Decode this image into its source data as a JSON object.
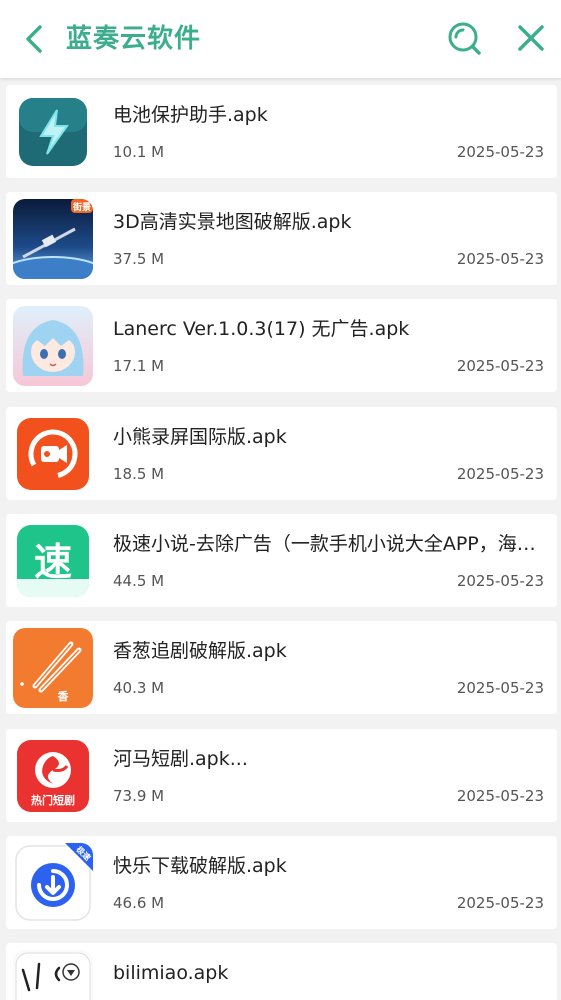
{
  "header": {
    "title": "蓝奏云软件",
    "accent_color": "#3cae8e",
    "back_icon": "chevron-left-icon",
    "search_icon": "search-icon",
    "close_icon": "close-icon"
  },
  "files": [
    {
      "name": "电池保护助手.apk",
      "size": "10.1 M",
      "date": "2025-05-23",
      "icon": "battery-bolt-app-icon"
    },
    {
      "name": "3D高清实景地图破解版.apk",
      "size": "37.5 M",
      "date": "2025-05-23",
      "icon": "satellite-map-app-icon",
      "badge": "街景"
    },
    {
      "name": "Lanerc Ver.1.0.3(17) 无广告.apk",
      "size": "17.1 M",
      "date": "2025-05-23",
      "icon": "anime-girl-app-icon"
    },
    {
      "name": "小熊录屏国际版.apk",
      "size": "18.5 M",
      "date": "2025-05-23",
      "icon": "screen-recorder-app-icon"
    },
    {
      "name": "极速小说-去除广告（一款手机小说大全APP，海量小说免费阅读）.apk",
      "size": "44.5 M",
      "date": "2025-05-23",
      "icon": "speed-novel-app-icon",
      "glyph": "速"
    },
    {
      "name": "香葱追剧破解版.apk",
      "size": "40.3 M",
      "date": "2025-05-23",
      "icon": "scallion-drama-app-icon",
      "glyph": "香"
    },
    {
      "name": "河马短剧.apk...",
      "size": "73.9 M",
      "date": "2025-05-23",
      "icon": "hippo-drama-app-icon",
      "badge": "热门短剧"
    },
    {
      "name": "快乐下载破解版.apk",
      "size": "46.6 M",
      "date": "2025-05-23",
      "icon": "happy-download-app-icon",
      "badge": "极速"
    },
    {
      "name": "bilimiao.apk",
      "size": "",
      "date": "",
      "icon": "bilimiao-app-icon"
    }
  ]
}
